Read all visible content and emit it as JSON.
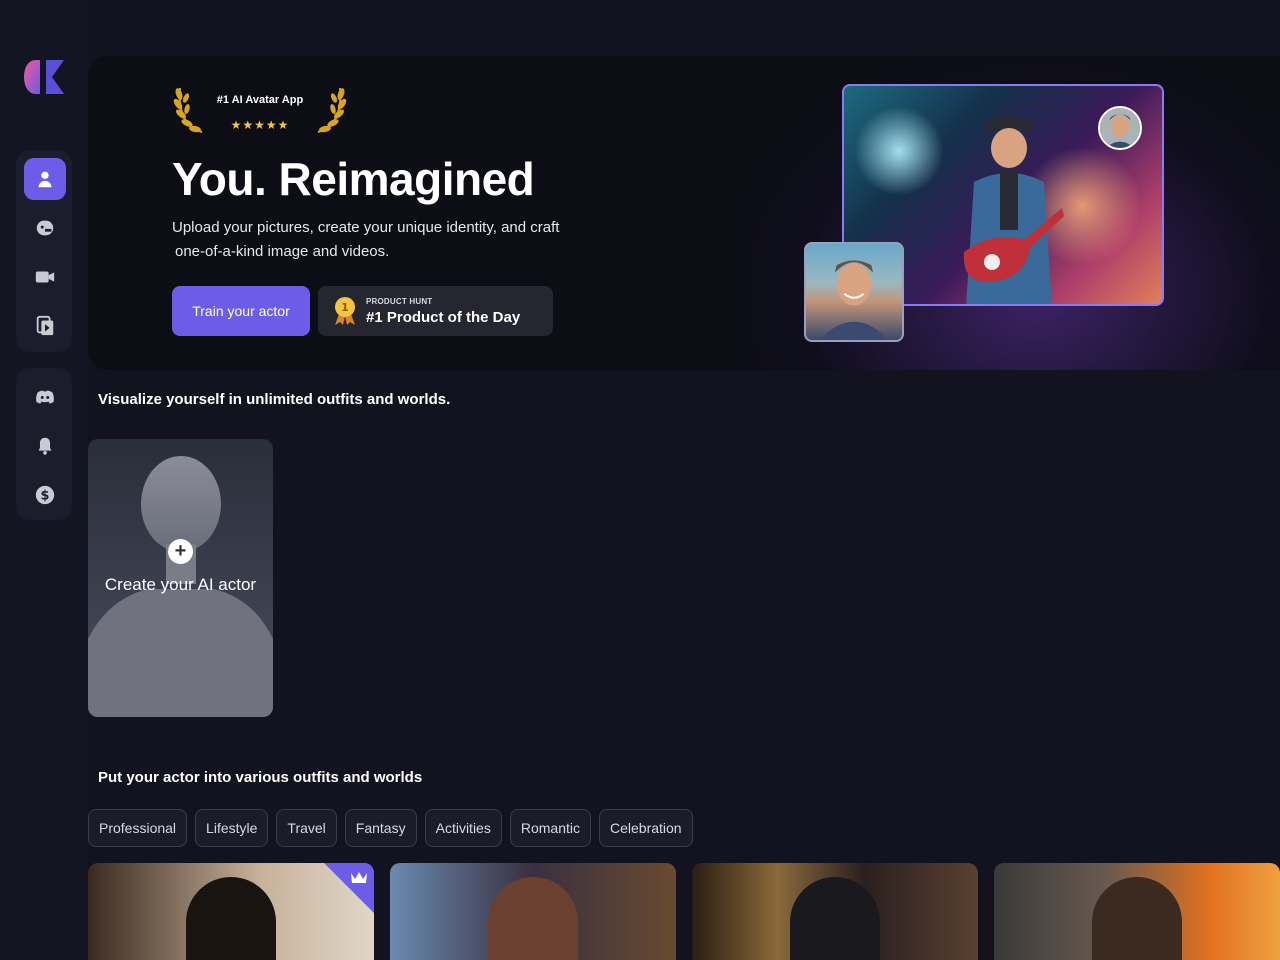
{
  "hero": {
    "award_title": "#1 AI Avatar App",
    "award_stars": "★★★★★",
    "title": "You. Reimagined",
    "subtitle_line1": "Upload your pictures, create your unique identity, and craft",
    "subtitle_line2": "one-of-a-kind image and videos.",
    "train_button": "Train your actor",
    "product_hunt_small": "PRODUCT HUNT",
    "product_hunt_big": "#1 Product of the Day",
    "medal_number": "1"
  },
  "sections": {
    "visualize_title": "Visualize yourself in unlimited outfits and worlds.",
    "create_card_label": "Create your AI actor",
    "create_card_plus": "+",
    "outfits_title": "Put your actor into various outfits and worlds"
  },
  "categories": [
    "Professional",
    "Lifestyle",
    "Travel",
    "Fantasy",
    "Activities",
    "Romantic",
    "Celebration"
  ],
  "sidebar": {
    "group1": [
      "user-icon",
      "avatar-face-icon",
      "video-camera-icon",
      "video-files-icon"
    ],
    "group2": [
      "discord-icon",
      "bell-icon",
      "dollar-icon"
    ]
  },
  "colors": {
    "accent": "#6c5ce7",
    "background": "#12131f",
    "gold": "#f5c542"
  }
}
